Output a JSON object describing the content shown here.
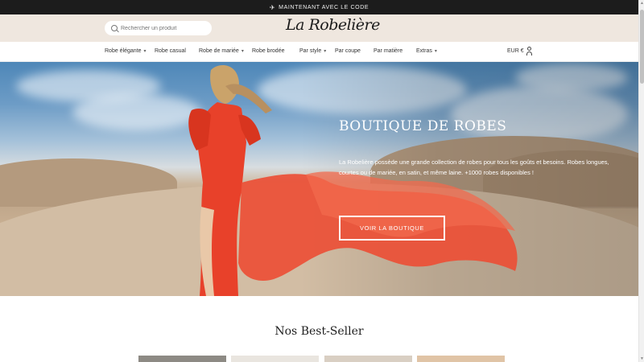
{
  "announcement": {
    "text": "MAINTENANT AVEC LE CODE",
    "icon": "plane-icon"
  },
  "header": {
    "search_placeholder": "Rechercher un produit",
    "logo": "La Robelière"
  },
  "nav": {
    "items": [
      {
        "label": "Robe élégante",
        "has_dropdown": true
      },
      {
        "label": "Robe casual",
        "has_dropdown": false
      },
      {
        "label": "Robe de mariée",
        "has_dropdown": true
      },
      {
        "label": "Robe brodée",
        "has_dropdown": false
      },
      {
        "label": "Par style",
        "has_dropdown": true
      },
      {
        "label": "Par coupe",
        "has_dropdown": false
      },
      {
        "label": "Par matière",
        "has_dropdown": false
      },
      {
        "label": "Extras",
        "has_dropdown": true
      }
    ],
    "currency": "EUR €"
  },
  "hero": {
    "title": "BOUTIQUE DE ROBES",
    "text": "La Robelière possède une grande collection de robes pour tous les goûts et besoins. Robes longues, courtes ou de mariée, en satin, et même laine. +1000 robes disponibles !",
    "button_label": "VOIR LA BOUTIQUE"
  },
  "best_sellers": {
    "title": "Nos Best-Seller",
    "products": [
      {
        "name": "product-1",
        "color": "#8d8a84"
      },
      {
        "name": "product-2",
        "color": "#e9e5df"
      },
      {
        "name": "product-3",
        "color": "#d9cfc3"
      },
      {
        "name": "product-4",
        "color": "#e0c4a6"
      }
    ]
  },
  "colors": {
    "announcement_bg": "#1c1c1c",
    "header_bg": "#efe7df",
    "dress": "#e8412a"
  }
}
